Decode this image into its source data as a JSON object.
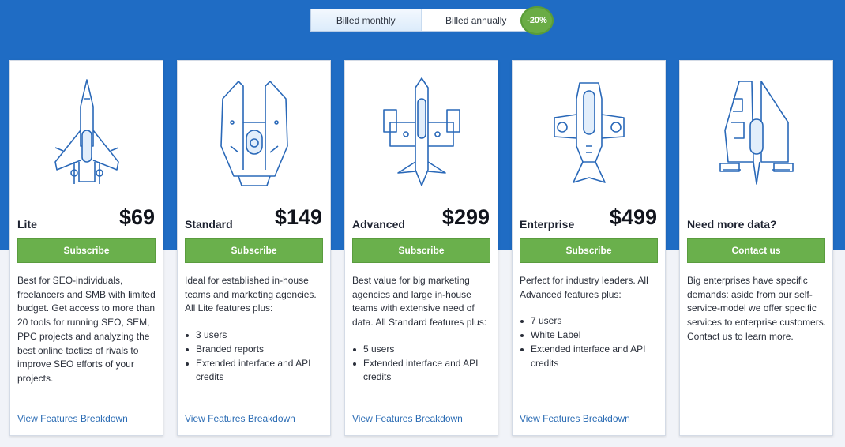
{
  "billing": {
    "monthly_label": "Billed monthly",
    "annually_label": "Billed annually",
    "discount_badge": "-20%",
    "active": "monthly"
  },
  "colors": {
    "brand_blue": "#1f6cc4",
    "button_green": "#6ab04c",
    "link_blue": "#2b6cb4"
  },
  "plans": [
    {
      "name": "Lite",
      "price": "$69",
      "button": "Subscribe",
      "description": "Best for SEO-individuals, freelancers and SMB with limited budget. Get access to more than 20 tools for running SEO, SEM, PPC projects and analyzing the best online tactics of rivals to improve SEO efforts of your projects.",
      "features": [],
      "link": "View Features Breakdown",
      "icon": "rocket-ship-icon"
    },
    {
      "name": "Standard",
      "price": "$149",
      "button": "Subscribe",
      "description": "Ideal for established in-house teams and marketing agencies. All Lite features plus:",
      "features": [
        "3 users",
        "Branded reports",
        "Extended interface and API credits"
      ],
      "link": "View Features Breakdown",
      "icon": "fork-ship-icon"
    },
    {
      "name": "Advanced",
      "price": "$299",
      "button": "Subscribe",
      "description": "Best value for big marketing agencies and large in-house teams with extensive need of data. All Standard features plus:",
      "features": [
        "5 users",
        "Extended interface and API credits"
      ],
      "link": "View Features Breakdown",
      "icon": "cruiser-ship-icon"
    },
    {
      "name": "Enterprise",
      "price": "$499",
      "button": "Subscribe",
      "description": "Perfect for industry leaders. All Advanced features plus:",
      "features": [
        "7 users",
        "White Label",
        "Extended interface and API credits"
      ],
      "link": "View Features Breakdown",
      "icon": "battle-ship-icon"
    },
    {
      "name": "Need more data?",
      "price": "",
      "button": "Contact us",
      "description": "Big enterprises have specific demands: aside from our self-service-model we offer specific services to enterprise customers. Contact us to learn more.",
      "features": [],
      "link": "",
      "icon": "mothership-icon"
    }
  ]
}
